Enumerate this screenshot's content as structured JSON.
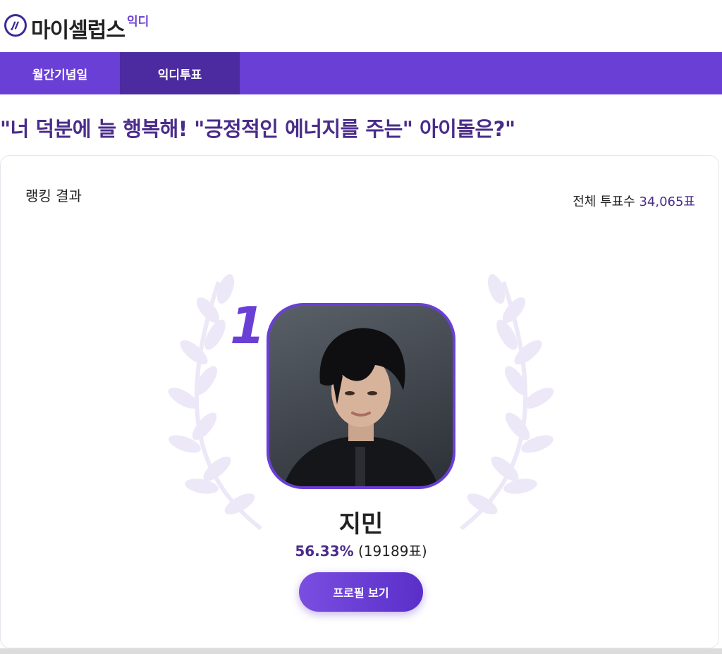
{
  "header": {
    "logo_text": "마이셀럽스",
    "logo_sub": "익디"
  },
  "nav": {
    "tabs": [
      {
        "label": "월간기념일"
      },
      {
        "label": "익디투표"
      }
    ]
  },
  "question": "\"너 덕분에 늘 행복해! \"긍정적인 에너지를 주는\" 아이돌은?\"",
  "result": {
    "label": "랭킹 결과",
    "total_prefix": "전체 투표수",
    "total_value": "34,065표"
  },
  "winner": {
    "rank": "1",
    "name": "지민",
    "percent": "56.33%",
    "votes": "(19189표)",
    "profile_button": "프로필 보기"
  },
  "colors": {
    "accent": "#6a3fd6",
    "dark_tab": "#4c2aa0",
    "text_accent": "#4a2c8a"
  }
}
